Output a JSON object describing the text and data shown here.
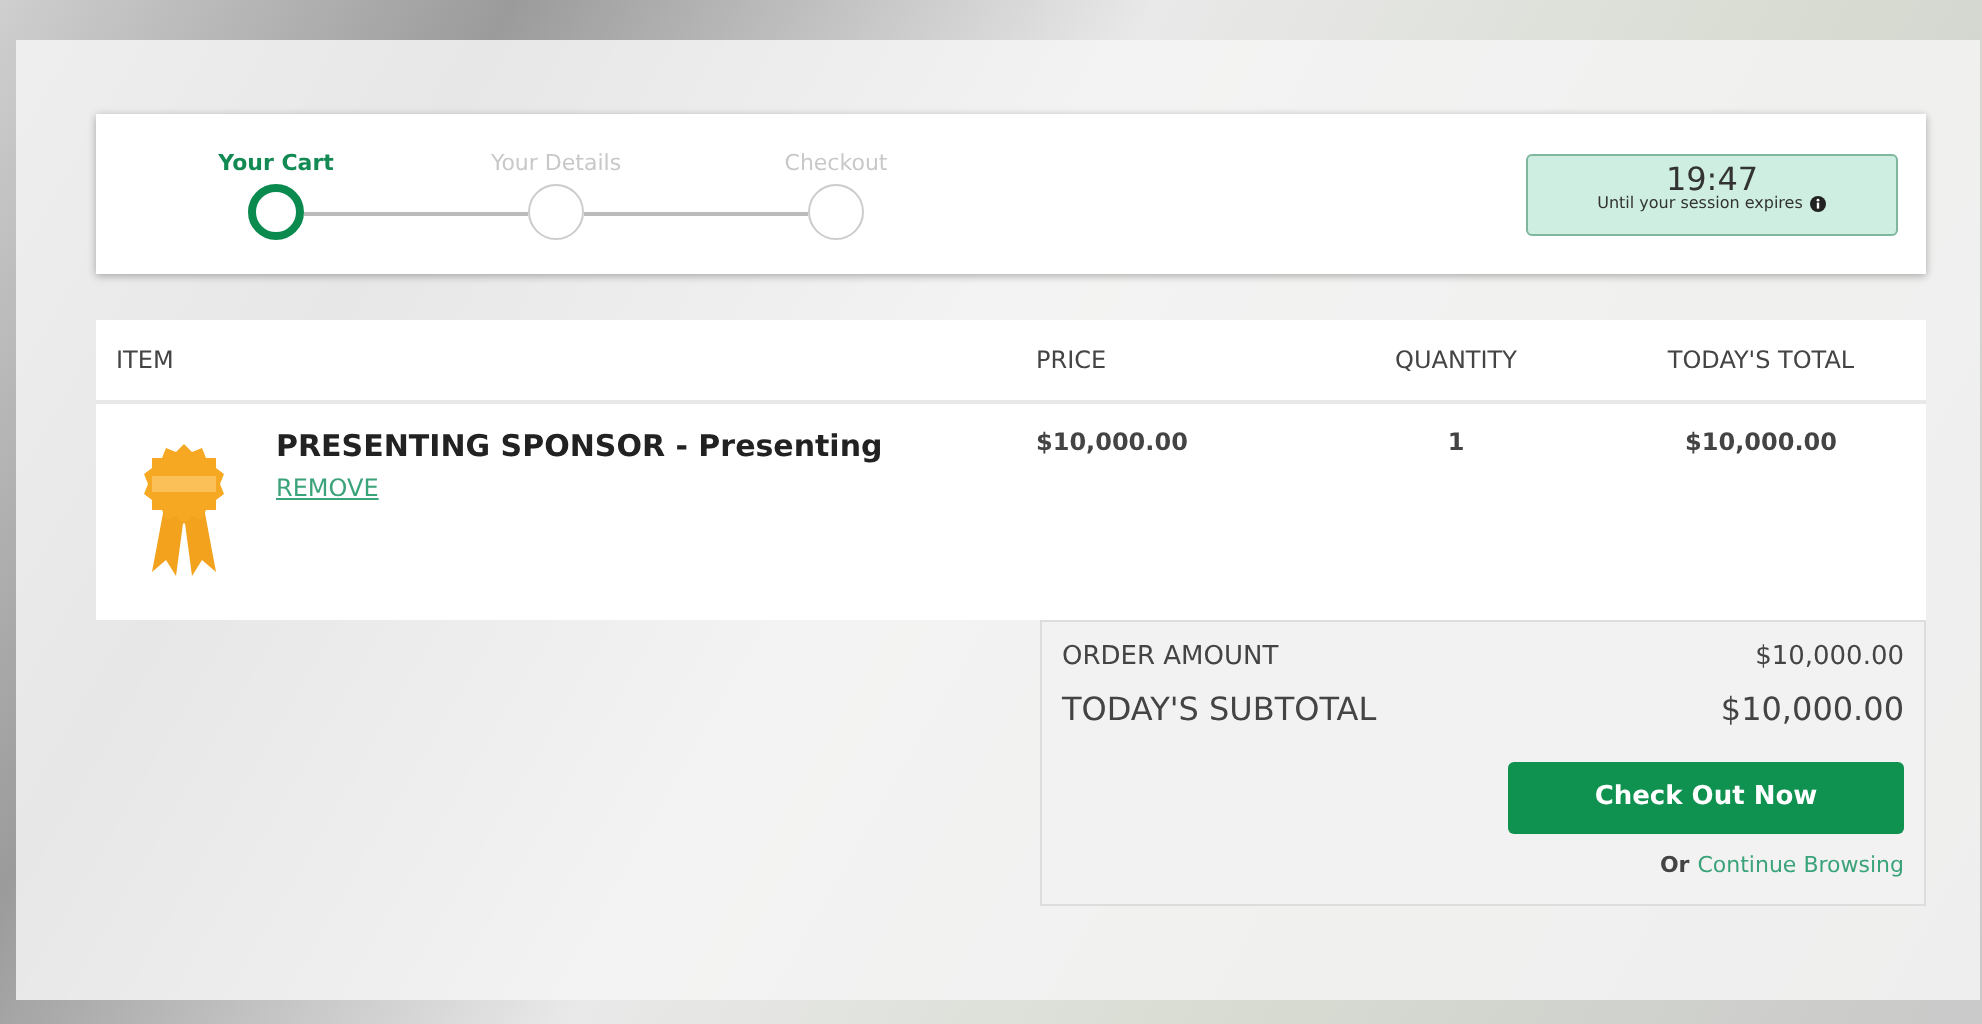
{
  "steps": [
    {
      "label": "Your Cart",
      "selected": true
    },
    {
      "label": "Your Details",
      "selected": false
    },
    {
      "label": "Checkout",
      "selected": false
    }
  ],
  "session_timer": {
    "time": "19:47",
    "note": "Until your session expires"
  },
  "cart_table": {
    "columns": [
      "ITEM",
      "PRICE",
      "QUANTITY",
      "TODAY'S TOTAL"
    ],
    "rows": [
      {
        "name": "PRESENTING SPONSOR - Presenting",
        "remove": "REMOVE",
        "price": "$10,000.00",
        "quantity": "1",
        "total": "$10,000.00"
      }
    ]
  },
  "summary": {
    "lines": [
      {
        "label": "ORDER AMOUNT",
        "value": "$10,000.00",
        "kind": "normal"
      },
      {
        "label": "TODAY'S SUBTOTAL",
        "value": "$10,000.00",
        "kind": "large"
      }
    ],
    "checkout_button": "Check Out Now",
    "or_text": "Or",
    "continue_link": "Continue Browsing"
  }
}
